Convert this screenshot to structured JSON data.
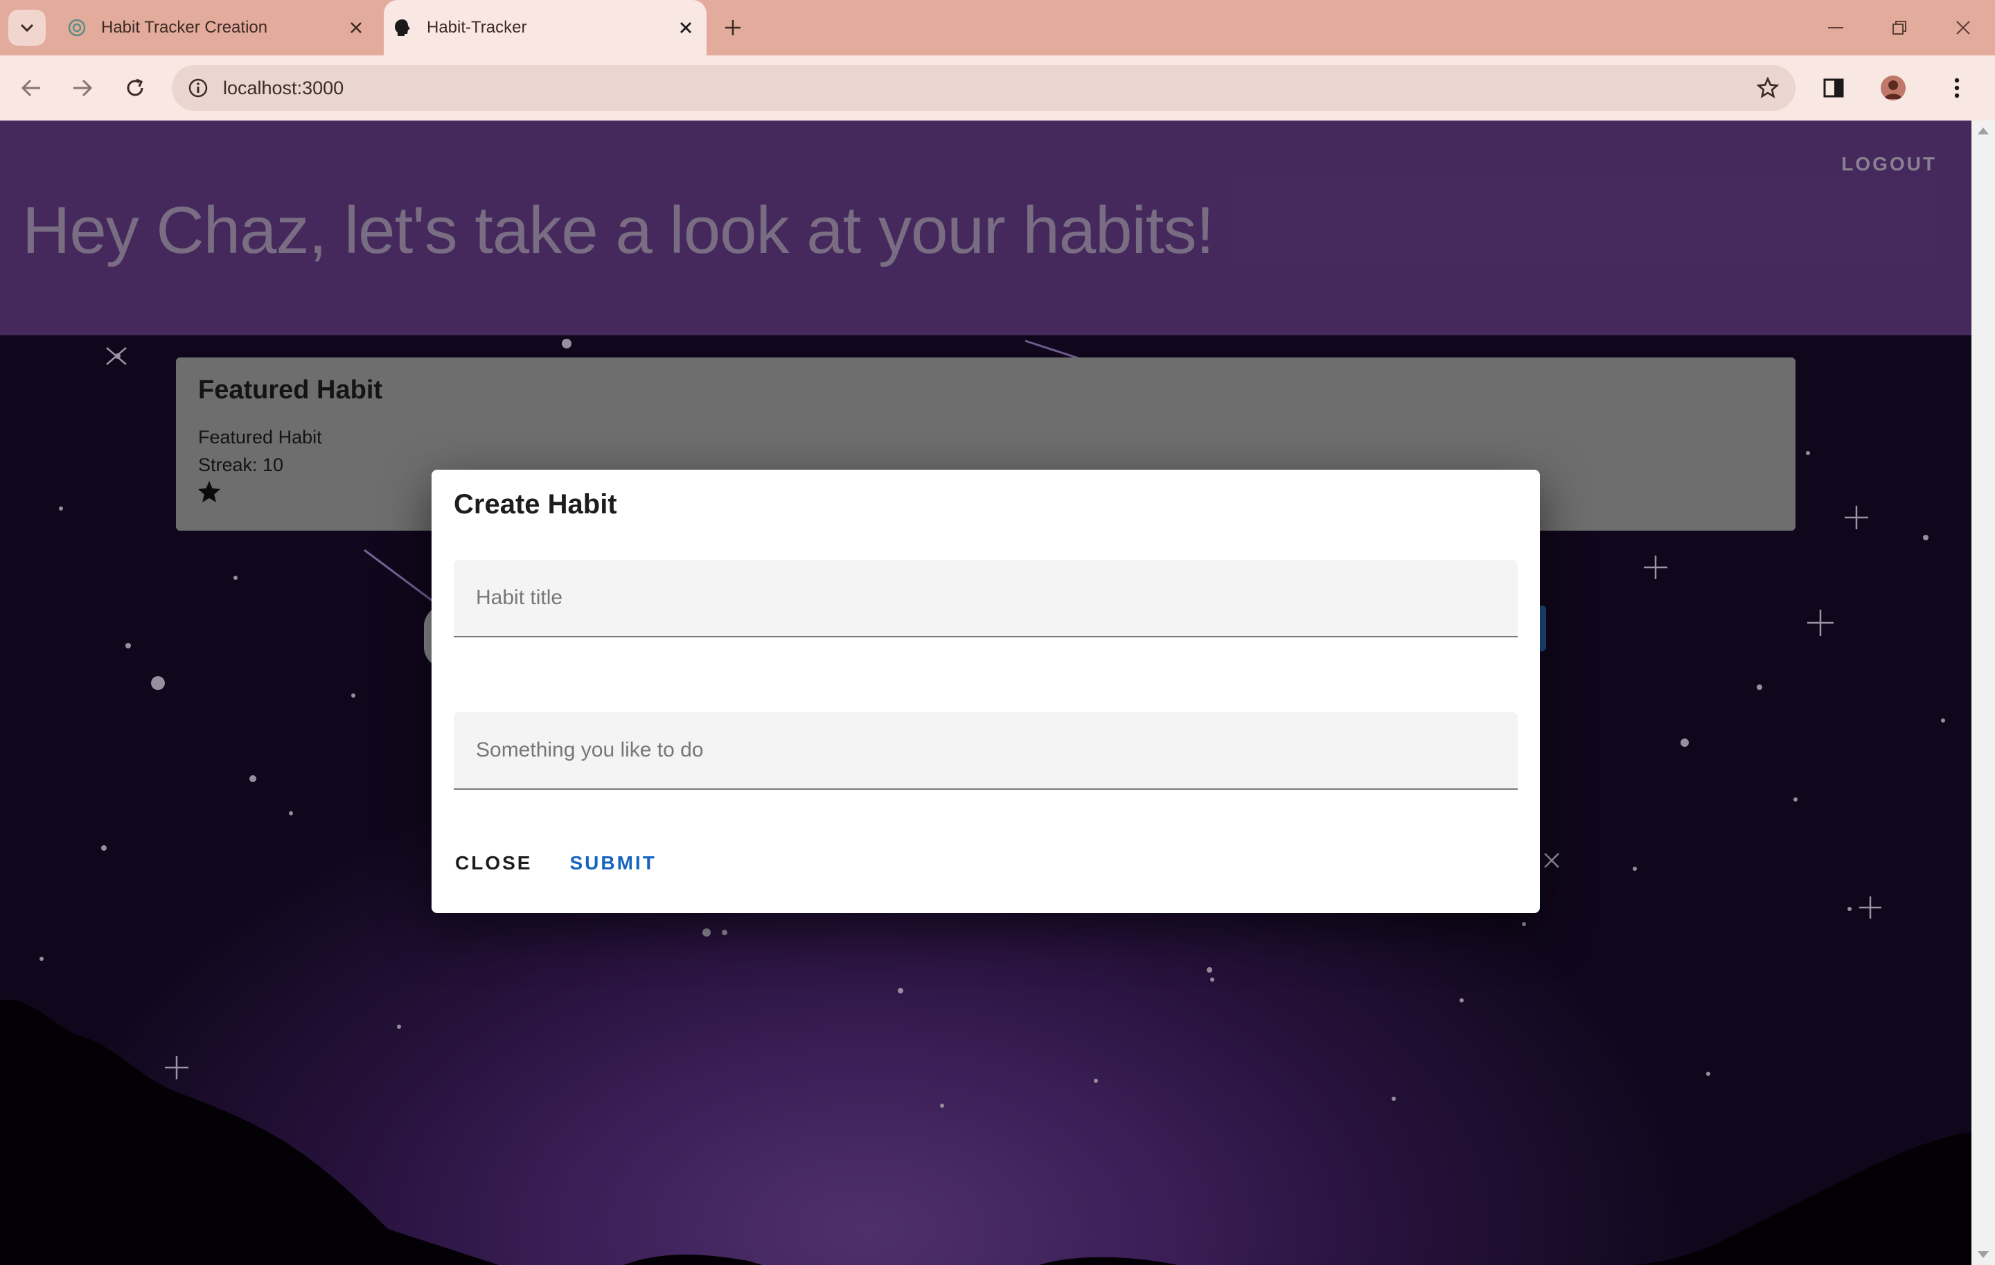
{
  "browser": {
    "tabs": [
      {
        "title": "Habit Tracker Creation",
        "active": false,
        "favicon": "chatgpt-icon"
      },
      {
        "title": "Habit-Tracker",
        "active": true,
        "favicon": "app-head-icon"
      }
    ],
    "url": "localhost:3000",
    "accent": "#e3ab9b"
  },
  "app": {
    "heading": "Hey Chaz, let's take a look at your habits!",
    "logout_label": "LOGOUT",
    "header_color": "#6a408f"
  },
  "featured": {
    "title": "Featured Habit",
    "habit_name": "Featured Habit",
    "streak_text": "Streak: 10",
    "icon": "star-icon"
  },
  "dialog": {
    "title": "Create Habit",
    "title_field": {
      "placeholder": "Habit title",
      "value": ""
    },
    "description_field": {
      "placeholder": "Something you like to do",
      "value": ""
    },
    "close_label": "CLOSE",
    "submit_label": "SUBMIT",
    "submit_color": "#1565c0"
  }
}
